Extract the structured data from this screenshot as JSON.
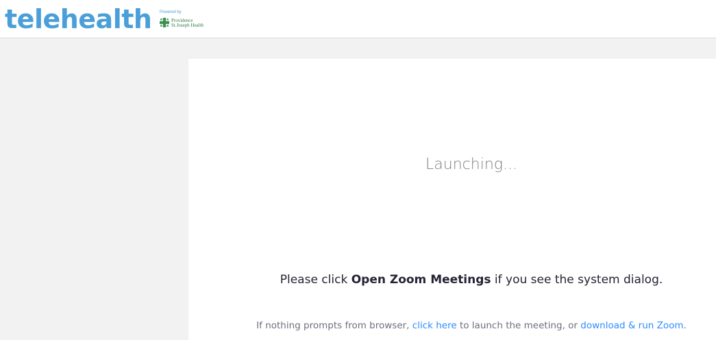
{
  "header": {
    "logo_text": "telehealth",
    "powered_by": "Powered by",
    "brand_line1": "Providence",
    "brand_line2": "St.Joseph Health",
    "logo_color": "#4a9fd8",
    "brand_color": "#2b7a3e",
    "brand_icon": "cross-icon"
  },
  "main": {
    "launching_text": "Launching...",
    "instruction": {
      "prefix": "Please click ",
      "bold": "Open Zoom Meetings",
      "suffix": " if you see the system dialog."
    },
    "fallback": {
      "prefix": "If nothing prompts from browser, ",
      "click_here": "click here",
      "middle": " to launch the meeting, or ",
      "download_link": "download & run Zoom",
      "suffix": "."
    },
    "link_color": "#2d8cff"
  }
}
